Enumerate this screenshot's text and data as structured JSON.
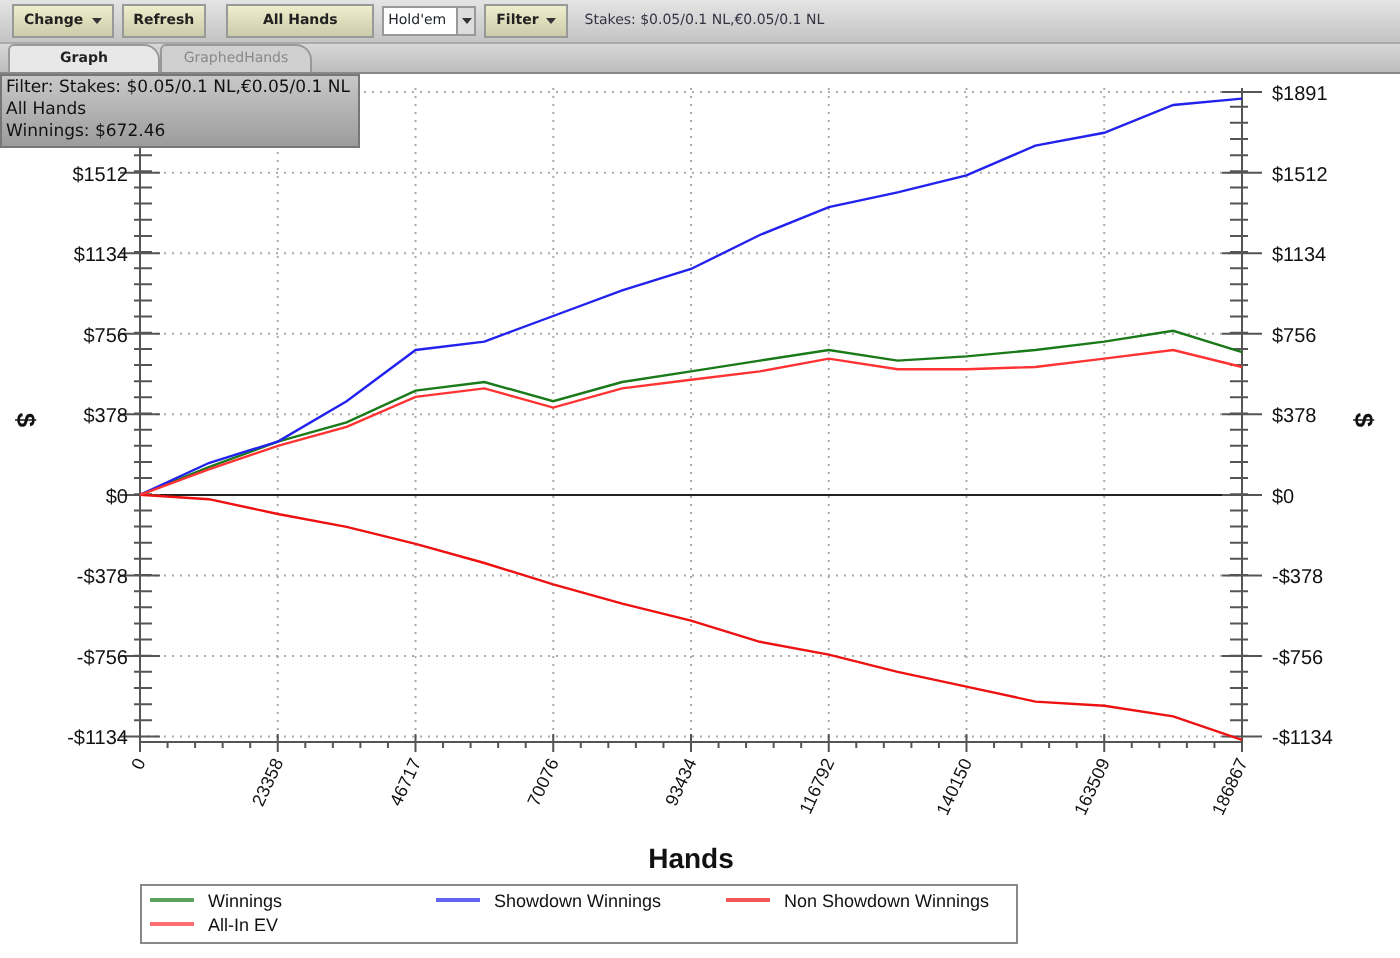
{
  "toolbar": {
    "items": [
      {
        "kind": "button",
        "label": "Change",
        "dropdown": true
      },
      {
        "kind": "button",
        "label": "Refresh",
        "dropdown": false
      },
      {
        "kind": "wide-button",
        "label": "All Hands",
        "dropdown": false
      },
      {
        "kind": "select",
        "value": "Hold'em"
      },
      {
        "kind": "button",
        "label": "Filter",
        "dropdown": true
      },
      {
        "kind": "text",
        "label": "Stakes: $0.05/0.1 NL,€0.05/0.1 NL"
      }
    ]
  },
  "tabs": [
    {
      "label": "Graph",
      "selected": true
    },
    {
      "label": "GraphedHands",
      "selected": false
    }
  ],
  "tooltip": {
    "lines": [
      "Filter: Stakes: $0.05/0.1 NL,€0.05/0.1 NL",
      "All Hands",
      "Winnings: $672.46"
    ]
  },
  "chart": {
    "chart_data": {
      "type": "line",
      "xlabel": "Hands",
      "ylabel": "$",
      "x": [
        0,
        11679,
        23358,
        35038,
        46717,
        58396,
        70076,
        81755,
        93434,
        105113,
        116792,
        128471,
        140150,
        151830,
        163509,
        175188,
        186867
      ],
      "series": [
        {
          "name": "Winnings",
          "color": "#1a7a1a",
          "values": [
            0,
            130,
            250,
            340,
            490,
            530,
            440,
            530,
            580,
            630,
            680,
            630,
            650,
            680,
            720,
            770,
            670
          ]
        },
        {
          "name": "Showdown Winnings",
          "color": "#2222ee",
          "values": [
            0,
            150,
            250,
            440,
            680,
            720,
            840,
            960,
            1060,
            1220,
            1350,
            1420,
            1500,
            1640,
            1700,
            1830,
            1860
          ]
        },
        {
          "name": "Non Showdown Winnings",
          "color": "#ee1111",
          "values": [
            0,
            -20,
            -90,
            -150,
            -230,
            -320,
            -420,
            -510,
            -590,
            -690,
            -750,
            -830,
            -900,
            -970,
            -990,
            -1040,
            -1150
          ]
        },
        {
          "name": "All-In EV",
          "color": "#ff3333",
          "values": [
            0,
            120,
            230,
            320,
            460,
            500,
            410,
            500,
            540,
            580,
            640,
            590,
            590,
            600,
            640,
            680,
            600
          ]
        }
      ],
      "grid": true,
      "legend": true,
      "xlim": [
        0,
        186867
      ],
      "ylim": [
        -1160,
        1910
      ],
      "xticks": [
        0,
        23358,
        46717,
        70076,
        93434,
        116792,
        140150,
        163509,
        186867
      ],
      "yticks": [
        {
          "value": 1891,
          "label": "$1891"
        },
        {
          "value": 1512,
          "label": "$1512"
        },
        {
          "value": 1134,
          "label": "$1134"
        },
        {
          "value": 756,
          "label": "$756"
        },
        {
          "value": 378,
          "label": "$378"
        },
        {
          "value": 0,
          "label": "$0"
        },
        {
          "value": -378,
          "label": "-$378"
        },
        {
          "value": -756,
          "label": "-$756"
        },
        {
          "value": -1134,
          "label": "-$1134"
        }
      ]
    }
  }
}
